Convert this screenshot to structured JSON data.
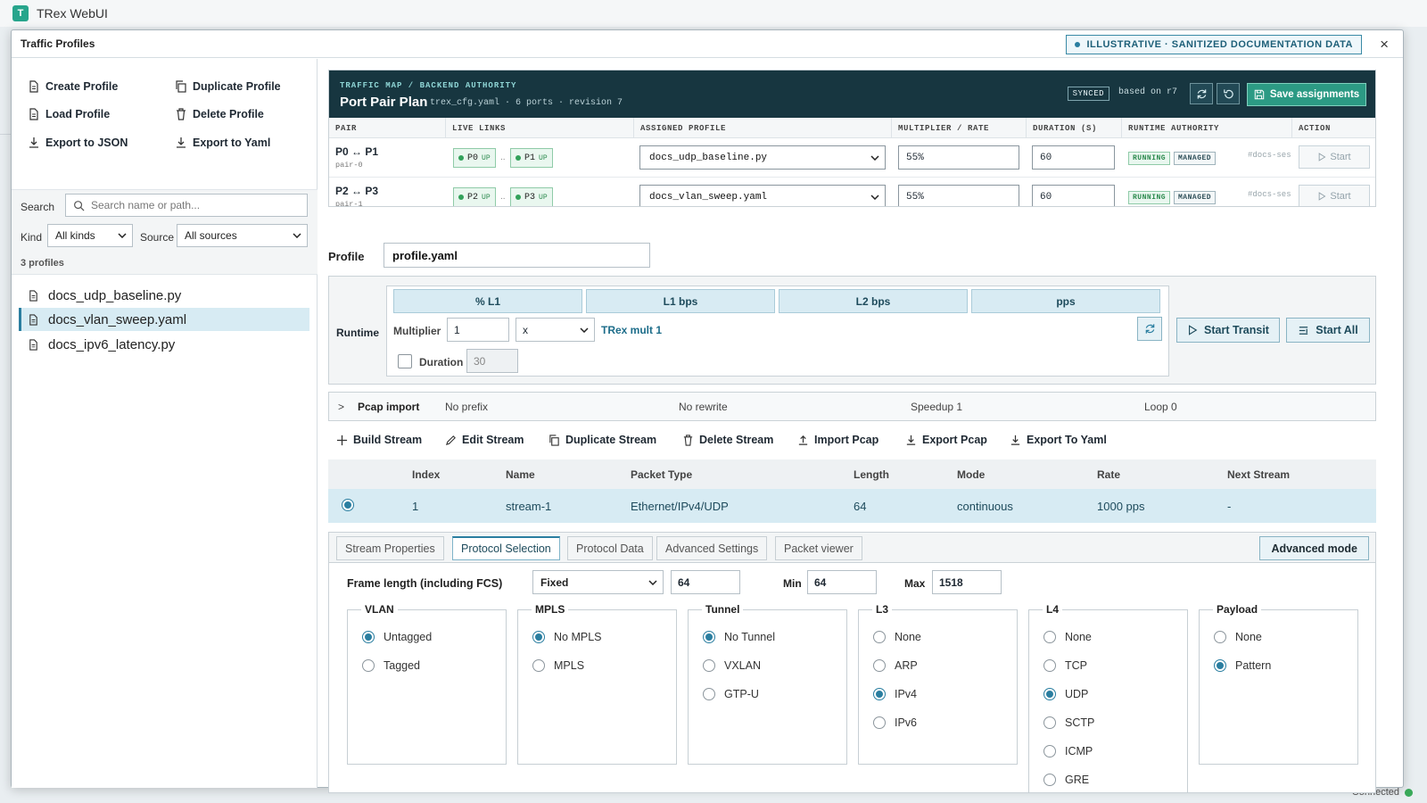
{
  "app": {
    "logo": "T",
    "title": "TRex WebUI"
  },
  "status": {
    "text": "Connected",
    "color": "#3aaa5a"
  },
  "modal": {
    "title": "Traffic Profiles",
    "banner": "ILLUSTRATIVE · SANITIZED DOCUMENTATION DATA",
    "close": "×"
  },
  "left": {
    "actions": {
      "create": "Create Profile",
      "duplicate": "Duplicate Profile",
      "load": "Load Profile",
      "delete": "Delete Profile",
      "export_json": "Export to JSON",
      "export_yaml": "Export to Yaml"
    },
    "search_label": "Search",
    "search_placeholder": "Search name or path...",
    "kind_label": "Kind",
    "kind_value": "All kinds",
    "source_label": "Source",
    "source_value": "All sources",
    "count": "3 profiles",
    "profiles": [
      "docs_udp_baseline.py",
      "docs_vlan_sweep.yaml",
      "docs_ipv6_latency.py"
    ],
    "selected_index": 1
  },
  "traffic_map": {
    "kicker": "TRAFFIC MAP / BACKEND AUTHORITY",
    "title": "Port Pair Plan",
    "subtitle": "trex_cfg.yaml · 6 ports · revision 7",
    "synced": "SYNCED",
    "based_on": "based on r7",
    "save": "Save assignments",
    "columns": [
      "PAIR",
      "LIVE LINKS",
      "ASSIGNED PROFILE",
      "MULTIPLIER / RATE",
      "DURATION (S)",
      "RUNTIME AUTHORITY",
      "ACTION"
    ],
    "rows": [
      {
        "pair": "P0 ↔ P1",
        "id": "pair-0",
        "a": "P0",
        "b": "P1",
        "up": "UP",
        "dots": "..",
        "profile": "docs_udp_baseline.py",
        "mult": "55%",
        "dur": "60",
        "running": "RUNNING",
        "managed": "MANAGED",
        "session": "#docs-ses",
        "action": "Start"
      },
      {
        "pair": "P2 ↔ P3",
        "id": "pair-1",
        "a": "P2",
        "b": "P3",
        "up": "UP",
        "dots": "..",
        "profile": "docs_vlan_sweep.yaml",
        "mult": "55%",
        "dur": "60",
        "running": "RUNNING",
        "managed": "MANAGED",
        "session": "#docs-ses",
        "action": "Start"
      }
    ]
  },
  "profile": {
    "label": "Profile",
    "value": "profile.yaml"
  },
  "runtime": {
    "label": "Runtime",
    "tabs": [
      "% L1",
      "L1 bps",
      "L2 bps",
      "pps"
    ],
    "multiplier_label": "Multiplier",
    "multiplier_value": "1",
    "unit_value": "x",
    "mult_text": "TRex mult 1",
    "duration_label": "Duration",
    "duration_value": "30",
    "duration_checked": false,
    "start_transit": "Start Transit",
    "start_all": "Start All"
  },
  "pcap": {
    "toggle": ">",
    "label": "Pcap import",
    "prefix": "No prefix",
    "rewrite": "No rewrite",
    "speedup": "Speedup 1",
    "loop": "Loop 0"
  },
  "stream_toolbar": {
    "build": "Build Stream",
    "edit": "Edit Stream",
    "duplicate": "Duplicate Stream",
    "delete": "Delete Stream",
    "import_pcap": "Import Pcap",
    "export_pcap": "Export Pcap",
    "export_yaml": "Export To Yaml"
  },
  "streams": {
    "columns": [
      "Index",
      "Name",
      "Packet Type",
      "Length",
      "Mode",
      "Rate",
      "Next Stream"
    ],
    "rows": [
      {
        "index": "1",
        "name": "stream-1",
        "type": "Ethernet/IPv4/UDP",
        "length": "64",
        "mode": "continuous",
        "rate": "1000 pps",
        "next": "-"
      }
    ]
  },
  "editor": {
    "tabs": [
      "Stream Properties",
      "Protocol Selection",
      "Protocol Data",
      "Advanced Settings",
      "Packet viewer"
    ],
    "active_tab": 1,
    "advanced": "Advanced mode",
    "frame_label": "Frame length (including FCS)",
    "frame_mode": "Fixed",
    "frame_value": "64",
    "min_label": "Min",
    "min_value": "64",
    "max_label": "Max",
    "max_value": "1518",
    "groups": [
      {
        "legend": "VLAN",
        "options": [
          "Untagged",
          "Tagged"
        ],
        "selected": 0
      },
      {
        "legend": "MPLS",
        "options": [
          "No MPLS",
          "MPLS"
        ],
        "selected": 0
      },
      {
        "legend": "Tunnel",
        "options": [
          "No Tunnel",
          "VXLAN",
          "GTP-U"
        ],
        "selected": 0
      },
      {
        "legend": "L3",
        "options": [
          "None",
          "ARP",
          "IPv4",
          "IPv6"
        ],
        "selected": 2
      },
      {
        "legend": "L4",
        "options": [
          "None",
          "TCP",
          "UDP",
          "SCTP",
          "ICMP",
          "GRE"
        ],
        "selected": 2
      },
      {
        "legend": "Payload",
        "options": [
          "None",
          "Pattern"
        ],
        "selected": 1
      }
    ]
  }
}
